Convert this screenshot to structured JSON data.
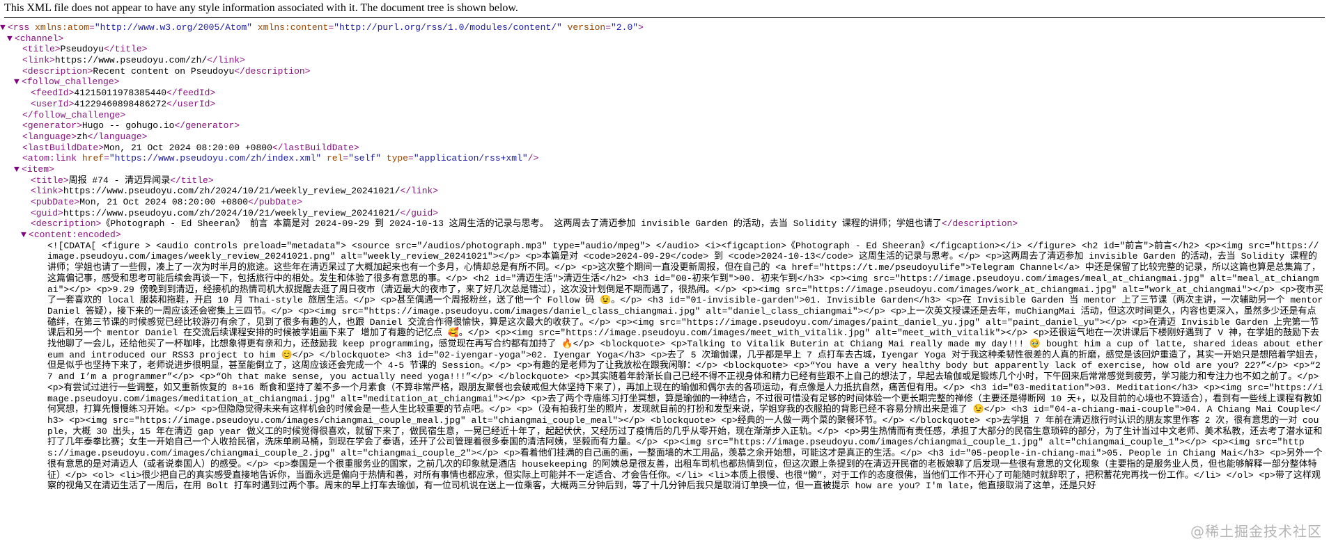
{
  "header": {
    "notice": "This XML file does not appear to have any style information associated with it. The document tree is shown below."
  },
  "rss": {
    "open_tag": "rss",
    "attr1_name": "xmlns:atom",
    "attr1_val": "\"http://www.w3.org/2005/Atom\"",
    "attr2_name": "xmlns:content",
    "attr2_val": "\"http://purl.org/rss/1.0/modules/content/\"",
    "attr3_name": "version",
    "attr3_val": "\"2.0\""
  },
  "channel": {
    "tag": "channel",
    "title": "Pseudoyu",
    "link": "https://www.pseudoyu.com/zh/",
    "description": "Recent content on Pseudoyu",
    "follow_challenge_tag": "follow_challenge",
    "feedId": "41215011978385440",
    "userId": "41229460898486272",
    "generator": "Hugo -- gohugo.io",
    "language": "zh",
    "lastBuildDate": "Mon, 21 Oct 2024 08:20:00 +0800",
    "atom_link_tag": "atom:link",
    "atom_href_name": "href",
    "atom_href_val": "\"https://www.pseudoyu.com/zh/index.xml\"",
    "atom_rel_name": "rel",
    "atom_rel_val": "\"self\"",
    "atom_type_name": "type",
    "atom_type_val": "\"application/rss+xml\""
  },
  "item": {
    "tag": "item",
    "title": "周报 #74 - 清迈异闻录",
    "link": "https://www.pseudoyu.com/zh/2024/10/21/weekly_review_20241021/",
    "pubDate": "Mon, 21 Oct 2024 08:20:00 +0800",
    "guid": "https://www.pseudoyu.com/zh/2024/10/21/weekly_review_20241021/",
    "description": "《Photograph - Ed Sheeran》 前言 本篇是对 2024-09-29 到 2024-10-13 这周生活的记录与思考。 这两周去了清迈参加 invisible Garden 的活动，去当 Solidity 课程的讲师；学姐也请了",
    "content_tag": "content:encoded",
    "content_text": "<![CDATA[ <figure > <audio controls preload=\"metadata\"> <source src=\"/audios/photograph.mp3\" type=\"audio/mpeg\"> </audio> <i><figcaption>《Photograph - Ed Sheeran》</figcaption></i> </figure> <h2 id=\"前言\">前言</h2> <p><img src=\"https://image.pseudoyu.com/images/weekly_review_20241021.png\" alt=\"weekly_review_20241021\"></p> <p>本篇是对 <code>2024-09-29</code> 到 <code>2024-10-13</code> 这周生活的记录与思考。</p> <p>这两周去了清迈参加 invisible Garden 的活动，去当 Solidity 课程的讲师；学姐也请了一些假，凑上了一次为时半月的旅途。这些年在清迈呆过了大概加起来也有一个多月，心情却总是有所不同。</p> <p>这次整个期间一直没更新周报，但在自己的 <a href=\"https://t.me/pseudoyulife\">Telegram Channel</a> 中还是保留了比较完整的记录，所以这篇也算是总集篇了，这篇偏记事，感受和思考可能后续会再谈一下，包括旅行中的相处。发生和体验了很多有意思的事。</p> <h2 id=\"清迈生活\">清迈生活</h2> <h3 id=\"00-初来乍到\">00. 初来乍到</h3> <p><img src=\"https://image.pseudoyu.com/images/meal_at_chiangmai.jpg\" alt=\"meal_at_chiangmai\"></p> <p>9.29 傍晚到到清迈，经接机的热情司机大叔提醒去逛了周日夜市（清迈最大的夜市了，来了好几次总是错过），这次没计划倒是不期而遇了，很热闹。</p> <p><img src=\"https://image.pseudoyu.com/images/work_at_chiangmai.jpg\" alt=\"work_at_chiangmai\"></p> <p>夜市买了一套喜欢的 local 服装和拖鞋，开启 10 月 Thai-style 旅居生活。</p> <p>甚至偶遇一个周报粉丝，送了他一个 Follow 码 😉。</p> <h3 id=\"01-invisible-garden\">01. Invisible Garden</h3> <p>在 Invisible Garden 当 mentor 上了三节课（两次主讲，一次辅助另一个 mentor Daniel 答疑），接下来的一周应该还会密集上三四节。</p> <p><img src=\"https://image.pseudoyu.com/images/daniel_class_chiangmai.jpg\" alt=\"daniel_class_chiangmai\"></p> <p>上一次英文授课还是去年，muChiangMai 活动，但这次时间更久，内容也更深入，虽然多少还是有点磕绊，在第三节课的时候感觉已经比较游刃有余了，见到了很多有趣的人，也跟 Daniel 交流合作得很愉快，算是这次最大的收获了。</p> <p><img src=\"https://image.pseudoyu.com/images/paint_daniel_yu.jpg\" alt=\"paint_daniel_yu\"></p> <p>在清迈 Invisible Garden 上完第一节课后和另一个 mentor Daniel 在交流后续课程安排的时候被学姐画下来了 增加了有趣的记忆点 🥰。</p> <p><img src=\"https://image.pseudoyu.com/images/meet_with_vitalik.jpg\" alt=\"meet_with_vitalik\"></p> <p>还很运气地在一次讲课后下楼刚好遇到了 V 神，在学姐的鼓励下去找他聊了一会儿，还给他买了一杯咖啡，比想象得更有亲和力，还鼓励我 keep programming，感觉现在再写合约都有加持了 🔥</p> <blockquote> <p>Talking to Vitalik Buterin at Chiang Mai really made my day!!! 🥹 bought him a cup of latte, shared ideas about ethereum and introduced our RSS3 project to him 😊</p> </blockquote> <h3 id=\"02-iyengar-yoga\">02. Iyengar Yoga</h3> <p>去了 5 次瑜伽课，几乎都是早上 7 点打车去古城，Iyengar Yoga 对于我这种柔韧性很差的人真的折磨，感觉是该回炉重造了，其实一开始只是想陪着学姐去，但是似乎也坚持下来了，老师说进步很明显，甚至能倒立了，这周应该还会完成一个 4-5 节课的 Session。</p> <p>有趣的是老师为了让我放松在跟我闲聊：</p> <blockquote> <p>“You have a very healthy body but apparently lack of exercise, how old are you? 22?”</p> <p>“27 and I’m a programmer”</p> <p>“Oh that make sense, you actually need yoga!!!”</p> </blockquote> <p>其实随着年龄渐长自己已经不得不正视身体和精力已经有些跟不上自己的想法了，早起去瑜伽或是锻炼几个小时，下午回来后常常感觉到疲劳，学习能力和专注力也不如之前了。</p> <p>有尝试过进行一些调整，如又重新恢复的 8+16 断食和坚持了差不多一个月素食（不算非常严格，跟朋友聚餐也会破戒但大体坚持下来了），再加上现在的瑜伽和偶尔去的各项运动，有点像是人力抵抗自然，痛苦但有用。</p> <h3 id=\"03-meditation\">03. Meditation</h3> <p><img src=\"https://image.pseudoyu.com/images/meditation_at_chiangmai.jpg\" alt=\"meditation_at_chiangmai\"></p> <p>去了两个寺庙练习打坐冥想，算是瑜伽的一种结合，不过很可惜没有足够的时间体验一个更长期完整的禅修（主要还是得断网 10 天+，以及目前的心境也不算适合），看到有一些线上课程有教如何冥想，打算先慢慢练习开始。</p> <p>但隐隐觉得未来有这样机会的时候会是一些人生比较重要的节点吧。</p> <p>（没有拍我打坐的照片，发现就目前的打扮和发型来说，学姐穿我的衣服拍的背影已经不容易分辨出来是谁了 😉</p> <h3 id=\"04-a-chiang-mai-couple\">04. A Chiang Mai Couple</h3> <p><img src=\"https://image.pseudoyu.com/images/chiangmai_couple_meal.jpg\" alt=\"chiangmai_couple_meal\"></p> <blockquote> <p>经典的一人做一两个菜的聚餐环节。</p> </blockquote> <p>去学姐 7 年前在清迈旅行时认识的朋友家里作客 2 次，很有意思的一对 couple，大概 30 出头，15 年在清迈 gap year 做义工的时候觉得很喜欢，就留下来了，做民宿生意，一晃已经近十年了，起起伏伏，又经历过了疫情后的几乎从零开始，现在渐渐步入正轨。</p> <p>男生热情而有责任感，承担了大部分的民宿生意琐碎的部分，为了生计当过中文老师、美术私教，还去考了潜水证和打了几年泰拳比赛；女生一开始自己一个人收拾民宿，洗床单刷马桶，到现在学会了泰语，还开了公司管理着很多泰国的清洁阿姨，坚毅而有力量。</p> <p><img src=\"https://image.pseudoyu.com/images/chiangmai_couple_1.jpg\" alt=\"chiangmai_couple_1\"></p> <p><img src=\"https://image.pseudoyu.com/images/chiangmai_couple_2.jpg\" alt=\"chiangmai_couple_2\"></p> <p>看着他们挂满的自己画的画，一整面墙的木工用品，羡慕之余开始想，可能这才是真正的生活。</p> <h3 id=\"05-people-in-chiang-mai\">05. People in Chiang Mai</h3> <p>另外一个很有意思的是对清迈人（或者说泰国人）的感受。</p> <p>泰国是一个很重服务业的国家，之前几次的印象就是酒店 housekeeping 的阿姨总是很友善，出租车司机也都热情到位，但这次跟上条提到的在清迈开民宿的老板娘聊了后发现一些很有意思的文化现象（主要指的是服务业人员，但也能够解释一部分整体特征）</p> <ol> <li>很少把自己的真实感受直接地告诉你，当面永远是偏向于热情和善，对所有事情也都应承，但实际上可能并不一定适合、才会告任你。</li> <li>本质上很慢、也很“懒”，对于工作的态度很佛，当他们工作不开心了可能随时就辞职了，把积蓄花完再找一份工作。</li> </ol> <p>带了这样观察的视角又在清迈生活了一周后，在用 Bolt 打车时遇到过两个事。周末的早上打车去瑜伽，有一位司机说在送上一位乘客，大概两三分钟后到，等了十几分钟后我只是取消订单换一位，但一直被提示 how are you? I'm late，他直接取消了这单，还是只好"
  },
  "watermark": "@稀土掘金技术社区"
}
